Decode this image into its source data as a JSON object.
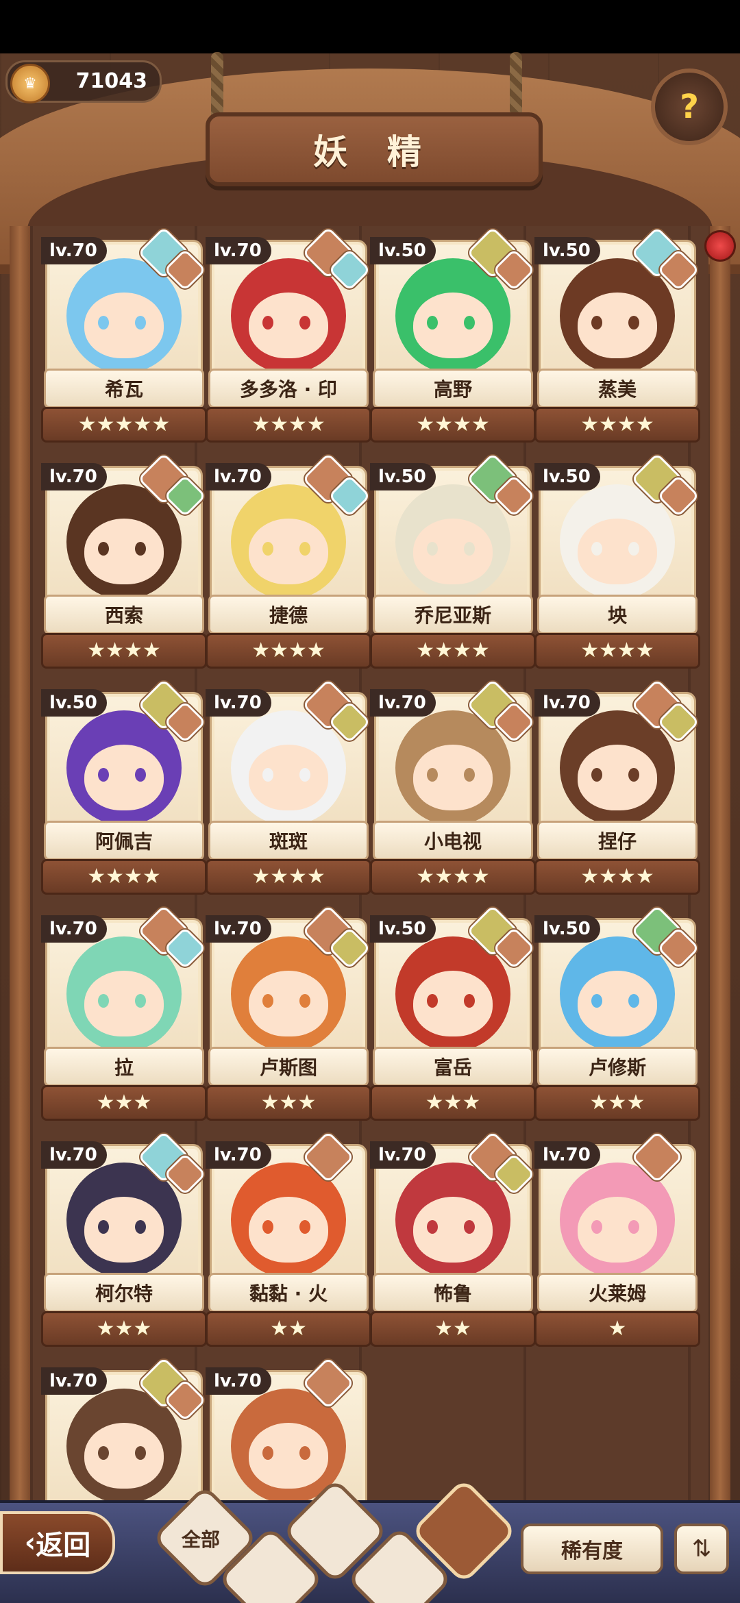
{
  "header": {
    "title": "妖 精",
    "currency_value": "71043",
    "help_icon": "question-bulb-icon"
  },
  "colors": {
    "elem_water": "#8fd3d8",
    "elem_fire": "#c7825c",
    "elem_earth": "#c9bd63",
    "elem_grass": "#7cc07a",
    "elem_wind": "#e6e3e0"
  },
  "cards": [
    {
      "level": "lv.70",
      "name": "希瓦",
      "stars": "★★★★★",
      "elements": [
        "water",
        "fire"
      ],
      "hair": "#7cc7ee"
    },
    {
      "level": "lv.70",
      "name": "多多洛 · 印",
      "stars": "★★★★",
      "elements": [
        "fire",
        "water"
      ],
      "hair": "#c83535"
    },
    {
      "level": "lv.50",
      "name": "高野",
      "stars": "★★★★",
      "elements": [
        "earth",
        "fire"
      ],
      "hair": "#3ac06a"
    },
    {
      "level": "lv.50",
      "name": "蒸美",
      "stars": "★★★★",
      "elements": [
        "water",
        "fire"
      ],
      "hair": "#6d3a24"
    },
    {
      "level": "lv.70",
      "name": "西索",
      "stars": "★★★★",
      "elements": [
        "fire",
        "grass"
      ],
      "hair": "#5a3522"
    },
    {
      "level": "lv.70",
      "name": "捷德",
      "stars": "★★★★",
      "elements": [
        "fire",
        "water"
      ],
      "hair": "#f0d36a"
    },
    {
      "level": "lv.50",
      "name": "乔尼亚斯",
      "stars": "★★★★",
      "elements": [
        "grass",
        "fire"
      ],
      "hair": "#e8e2cc"
    },
    {
      "level": "lv.50",
      "name": "坱",
      "stars": "★★★★",
      "elements": [
        "earth",
        "fire"
      ],
      "hair": "#f4f1ea"
    },
    {
      "level": "lv.50",
      "name": "阿佩吉",
      "stars": "★★★★",
      "elements": [
        "earth",
        "fire"
      ],
      "hair": "#6a3fb5"
    },
    {
      "level": "lv.70",
      "name": "斑斑",
      "stars": "★★★★",
      "elements": [
        "fire",
        "earth"
      ],
      "hair": "#f2f2f2"
    },
    {
      "level": "lv.70",
      "name": "小电视",
      "stars": "★★★★",
      "elements": [
        "earth",
        "fire"
      ],
      "hair": "#b68a5d"
    },
    {
      "level": "lv.70",
      "name": "捏仔",
      "stars": "★★★★",
      "elements": [
        "fire",
        "earth"
      ],
      "hair": "#6b3e28"
    },
    {
      "level": "lv.70",
      "name": "拉",
      "stars": "★★★",
      "elements": [
        "fire",
        "water"
      ],
      "hair": "#7fd6b5"
    },
    {
      "level": "lv.70",
      "name": "卢斯图",
      "stars": "★★★",
      "elements": [
        "fire",
        "earth"
      ],
      "hair": "#e07f3b"
    },
    {
      "level": "lv.50",
      "name": "富岳",
      "stars": "★★★",
      "elements": [
        "earth",
        "fire"
      ],
      "hair": "#c23a2a"
    },
    {
      "level": "lv.50",
      "name": "卢修斯",
      "stars": "★★★",
      "elements": [
        "grass",
        "fire"
      ],
      "hair": "#5fb7e8"
    },
    {
      "level": "lv.70",
      "name": "柯尔特",
      "stars": "★★★",
      "elements": [
        "water",
        "fire"
      ],
      "hair": "#3c3450"
    },
    {
      "level": "lv.70",
      "name": "黏黏 · 火",
      "stars": "★★",
      "elements": [
        "fire"
      ],
      "hair": "#e05b2e"
    },
    {
      "level": "lv.70",
      "name": "怖鲁",
      "stars": "★★",
      "elements": [
        "fire",
        "earth"
      ],
      "hair": "#c0393e"
    },
    {
      "level": "lv.70",
      "name": "火莱姆",
      "stars": "★",
      "elements": [
        "fire"
      ],
      "hair": "#f39ab6"
    },
    {
      "level": "lv.70",
      "name": "",
      "stars": "",
      "elements": [
        "earth",
        "fire"
      ],
      "hair": "#6a4530"
    },
    {
      "level": "lv.70",
      "name": "",
      "stars": "",
      "elements": [
        "fire"
      ],
      "hair": "#c96a3d"
    }
  ],
  "bottom": {
    "back_label": "返回",
    "tab_all_label": "全部",
    "rarity_label": "稀有度",
    "sort_icon": "sort-icon"
  }
}
